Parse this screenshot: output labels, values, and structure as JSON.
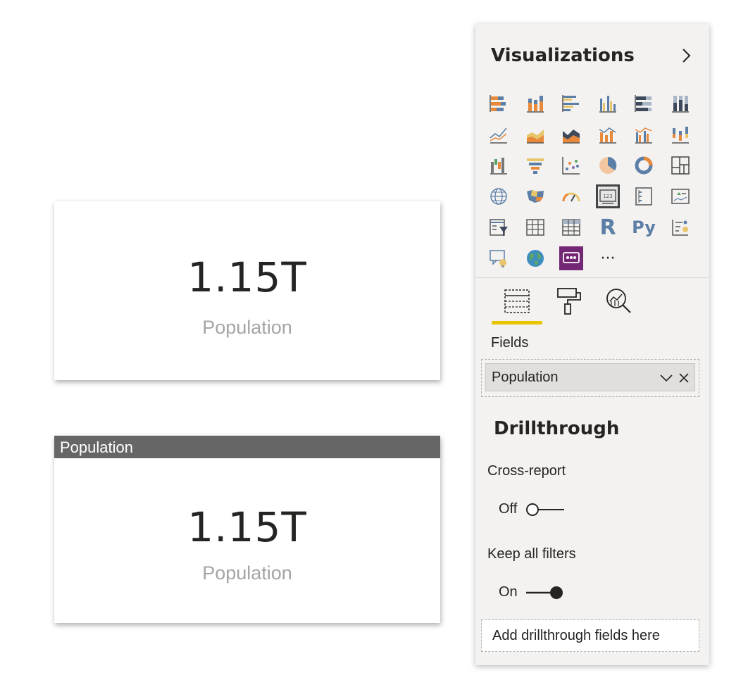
{
  "cards": [
    {
      "value": "1.15T",
      "label": "Population"
    },
    {
      "title": "Population",
      "value": "1.15T",
      "label": "Population"
    }
  ],
  "pane": {
    "title": "Visualizations",
    "visuals": [
      "stacked-bar-chart-icon",
      "stacked-column-chart-icon",
      "clustered-bar-chart-icon",
      "clustered-column-chart-icon",
      "100-stacked-bar-chart-icon",
      "100-stacked-column-chart-icon",
      "line-chart-icon",
      "area-chart-icon",
      "stacked-area-chart-icon",
      "line-and-stacked-column-chart-icon",
      "line-and-clustered-column-chart-icon",
      "ribbon-chart-icon",
      "waterfall-chart-icon",
      "funnel-icon",
      "scatter-chart-icon",
      "pie-chart-icon",
      "donut-chart-icon",
      "treemap-icon",
      "map-icon",
      "filled-map-icon",
      "gauge-icon",
      "card-icon",
      "multi-row-card-icon",
      "kpi-icon",
      "slicer-icon",
      "table-icon",
      "matrix-icon",
      "r-visual-icon",
      "python-visual-icon",
      "key-influencers-icon",
      "qa-icon",
      "arcgis-map-icon",
      "powerapps-icon",
      "more-visuals-icon"
    ],
    "selected_visual": "card-icon",
    "r_glyph": "R",
    "py_glyph": "Py",
    "more_glyph": "···",
    "tabs": [
      "fields-tab-icon",
      "format-tab-icon",
      "analytics-tab-icon"
    ],
    "fields_label": "Fields",
    "field_value": "Population",
    "drillthrough": {
      "title": "Drillthrough",
      "cross_report_label": "Cross-report",
      "cross_report_state": "Off",
      "keep_filters_label": "Keep all filters",
      "keep_filters_state": "On",
      "add_fields_placeholder": "Add drillthrough fields here"
    },
    "colors": {
      "accent": "#e8c500",
      "bar_orange": "#e8883a",
      "bar_blue": "#5b7fa6",
      "powerapps_purple": "#742774"
    }
  }
}
